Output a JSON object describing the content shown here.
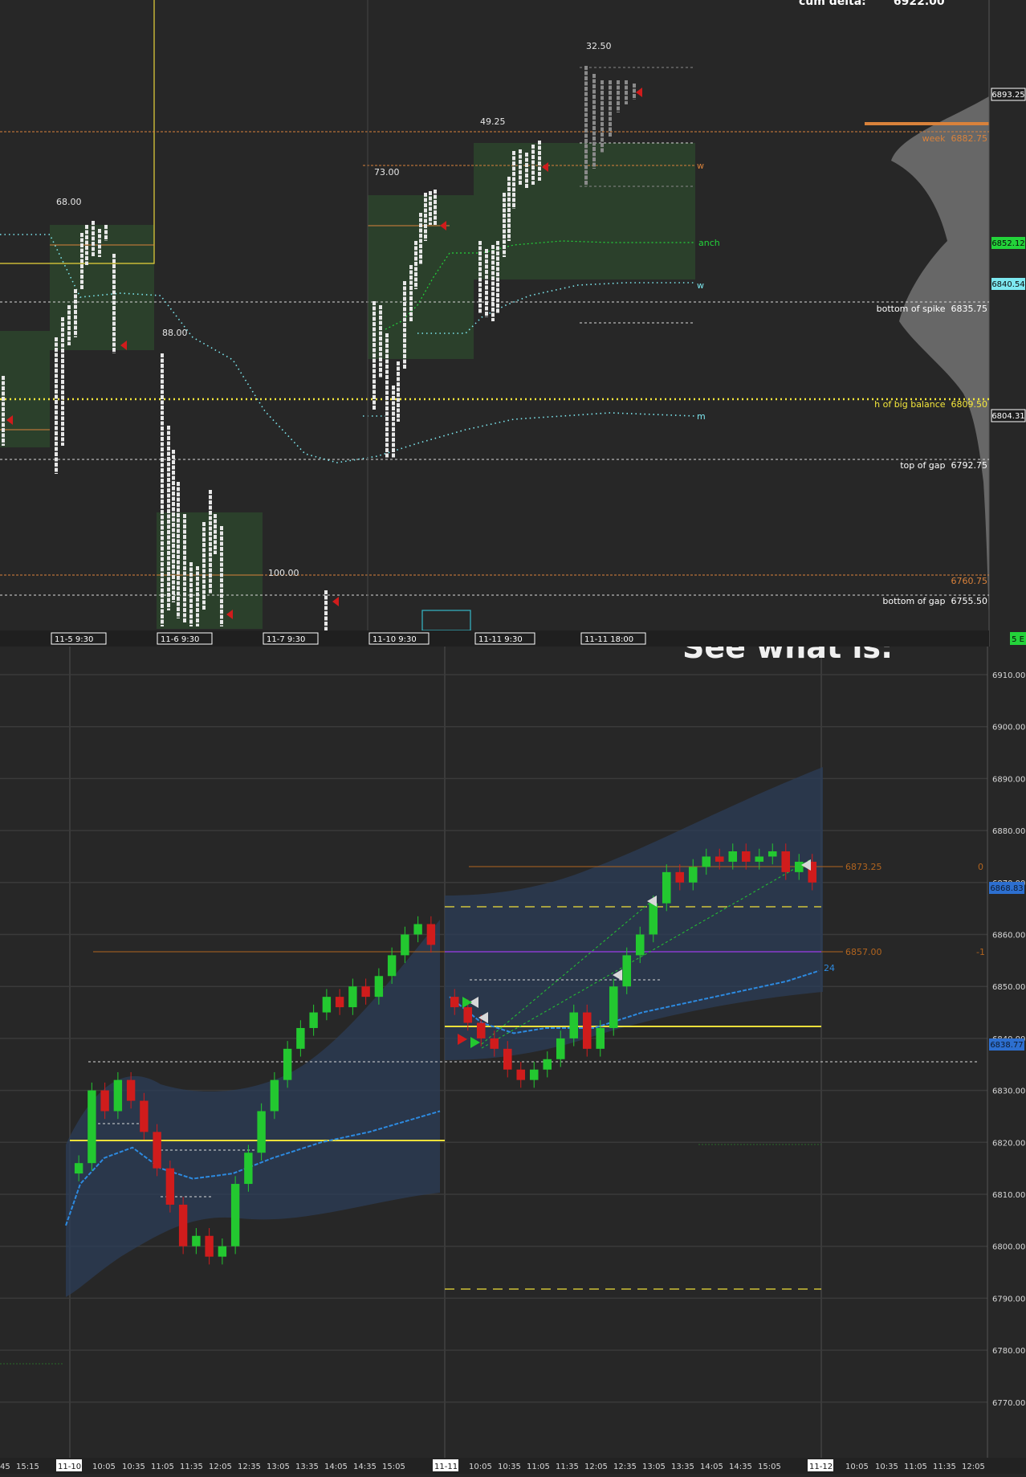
{
  "top_panel": {
    "header_text": "cum delta:       6922.00",
    "tpo_counts": [
      {
        "text": "68.00"
      },
      {
        "text": "88.00"
      },
      {
        "text": "100.00"
      },
      {
        "text": "73.00"
      },
      {
        "text": "49.25"
      },
      {
        "text": "32.50"
      }
    ],
    "level_labels": [
      {
        "text": "week  6882.75",
        "color": "#d9823b"
      },
      {
        "text": "bottom of spike  6835.75",
        "color": "#ffffff"
      },
      {
        "text": "h of big balance  6809.50",
        "color": "#f5e83b"
      },
      {
        "text": "top of gap  6792.75",
        "color": "#ffffff"
      },
      {
        "text": "6760.75",
        "color": "#d9823b"
      },
      {
        "text": "bottom of gap  6755.50",
        "color": "#ffffff"
      }
    ],
    "line_tags": [
      "w",
      "anch",
      "w",
      "m"
    ],
    "price_tags": [
      {
        "text": "6893.25",
        "color": "#ffffff"
      },
      {
        "text": "6852.12",
        "color": "#23d33a"
      },
      {
        "text": "6840.54",
        "color": "#7de8f0"
      },
      {
        "text": "6804.31",
        "color": "#ffffff"
      }
    ],
    "date_axis": [
      "11-5  9:30",
      "11-6  9:30",
      "11-7  9:30",
      "11-10  9:30",
      "11-11  9:30",
      "11-11  18:00"
    ],
    "corner_tag": "5 E"
  },
  "bottom_panel": {
    "overlay_title": "See what is:",
    "price_axis": [
      "6910.00",
      "6900.00",
      "6890.00",
      "6880.00",
      "6870.00",
      "6860.00",
      "6850.00",
      "6840.00",
      "6830.00",
      "6820.00",
      "6810.00",
      "6800.00",
      "6790.00",
      "6780.00",
      "6770.00"
    ],
    "line_labels": [
      {
        "text": "6873.25",
        "color": "#b0641f"
      },
      {
        "text": "6857.00",
        "color": "#b0641f"
      },
      {
        "text": "0",
        "color": "#b0641f"
      },
      {
        "text": "-1",
        "color": "#b0641f"
      },
      {
        "text": "24",
        "color": "#2d8ae0"
      }
    ],
    "price_tags": [
      {
        "text": "6868.83",
        "color": "#2d6fd0"
      },
      {
        "text": "6838.77",
        "color": "#2d6fd0"
      }
    ],
    "time_axis": [
      "45",
      "15:15",
      "11-10",
      "10:05",
      "10:35",
      "11:05",
      "11:35",
      "12:05",
      "12:35",
      "13:05",
      "13:35",
      "14:05",
      "14:35",
      "15:05",
      "11-11",
      "10:05",
      "10:35",
      "11:05",
      "11:35",
      "12:05",
      "12:35",
      "13:05",
      "13:35",
      "14:05",
      "14:35",
      "15:05",
      "11-12",
      "10:05",
      "10:35",
      "11:05",
      "11:35",
      "12:05"
    ],
    "colors": {
      "up": "#23c830",
      "down": "#d01c1c",
      "vwap": "#2d8ae0",
      "band": "#2c3e58",
      "yellow": "#f0e03a",
      "orange": "#b0641f",
      "purple": "#8a3cd0"
    }
  },
  "chart_data": {
    "type": "candlestick",
    "ylim": [
      6765,
      6915
    ],
    "vwap_label": "24",
    "segments": [
      {
        "session": "11-10",
        "closes": [
          6816,
          6830,
          6826,
          6832,
          6828,
          6822,
          6815,
          6808,
          6800,
          6802,
          6798,
          6800,
          6812,
          6818,
          6826,
          6832,
          6838,
          6842,
          6845,
          6848,
          6846,
          6850,
          6848,
          6852,
          6856,
          6860,
          6862,
          6858
        ]
      },
      {
        "session": "11-11",
        "closes": [
          6846,
          6843,
          6840,
          6838,
          6834,
          6832,
          6834,
          6836,
          6840,
          6845,
          6838,
          6842,
          6850,
          6856,
          6860,
          6866,
          6872,
          6870,
          6873,
          6875,
          6874,
          6876,
          6874,
          6875,
          6876,
          6872,
          6874,
          6870
        ]
      }
    ]
  }
}
